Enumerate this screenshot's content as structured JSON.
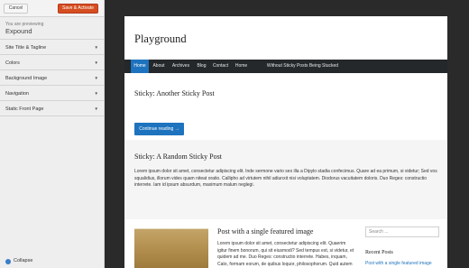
{
  "customizer": {
    "cancel_label": "Cancel",
    "save_label": "Save & Activate",
    "previewing_label": "You are previewing",
    "theme_name": "Expound",
    "sections": [
      {
        "label": "Site Title & Tagline"
      },
      {
        "label": "Colors"
      },
      {
        "label": "Background Image"
      },
      {
        "label": "Navigation"
      },
      {
        "label": "Static Front Page"
      }
    ],
    "section_arrow": "▼",
    "collapse_label": "Collapse"
  },
  "site": {
    "title": "Playground",
    "nav": [
      {
        "label": "Home",
        "active": true
      },
      {
        "label": "About"
      },
      {
        "label": "Archives"
      },
      {
        "label": "Blog"
      },
      {
        "label": "Contact"
      },
      {
        "label": "Home"
      },
      {
        "label": "Without Sticky Posts Being Stucked"
      }
    ],
    "posts": [
      {
        "title": "Sticky: Another Sticky Post",
        "button": "Continue reading →"
      },
      {
        "title": "Sticky: A Random Sticky Post",
        "excerpt_lines": [
          "Lorem ipsum dolor sit amet, consectetur adipiscing elit. Inde sermone vario sex illa a Dipylo stadia confecimus. Quare ad ea primum, si videtur; Sed vos",
          "squalidius, illorum vides quam niteat oratio. Callipho ad virtutem nihil adiunxit nisi voluptatem. Diodorus vacuitatem doloris. Duo Reges: constructio",
          "interrete. Iam id ipsum absurdum, maximum malum neglegi."
        ]
      },
      {
        "title": "Post with a single featured image",
        "excerpt_lines": [
          "Lorem ipsum dolor sit amet, consectetur adipiscing elit. Quaerim",
          "igitur finem bonorum, qui sit eiusmodi? Sed tempus est, si videtur, et recta",
          "quidem ad me. Duo Reges: constructio interrete. Habes, inquam,",
          "Cato, formam eorum, de quibus loquor, philosophorum. Quid autem"
        ]
      }
    ],
    "sidebar": {
      "search_placeholder": "Search ...",
      "recent_posts_title": "Recent Posts",
      "recent_post_link": "Post with a single featured image"
    }
  }
}
